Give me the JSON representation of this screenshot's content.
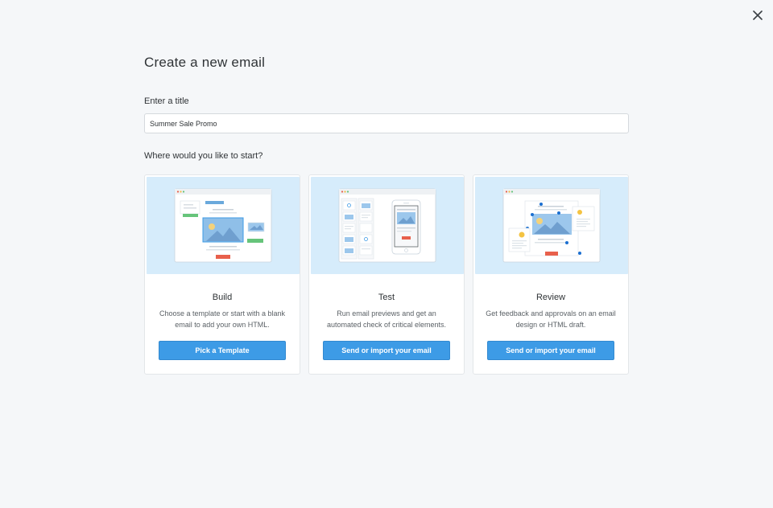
{
  "dialog": {
    "title": "Create a new email",
    "title_field_label": "Enter a title",
    "title_field_value": "Summer Sale Promo",
    "start_question": "Where would you like to start?"
  },
  "cards": [
    {
      "title": "Build",
      "description": "Choose a template or start with a blank email to add your own HTML.",
      "button_label": "Pick a Template"
    },
    {
      "title": "Test",
      "description": "Run email previews and get an automated check of critical elements.",
      "button_label": "Send or import your email"
    },
    {
      "title": "Review",
      "description": "Get feedback and approvals on an email design or HTML draft.",
      "button_label": "Send or import your email"
    }
  ],
  "icons": {
    "close": "close-icon"
  },
  "colors": {
    "accent": "#3d9be6",
    "art_background": "#d6ecfb",
    "page_background": "#f5f7f9"
  }
}
